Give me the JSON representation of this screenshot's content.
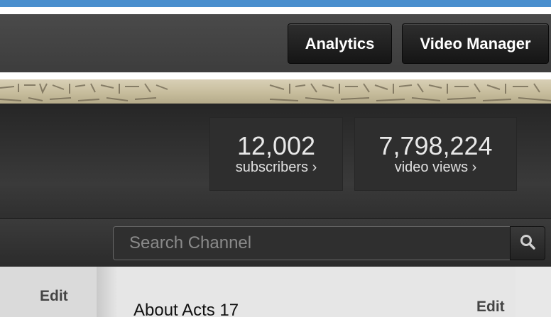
{
  "toolbar": {
    "analytics_label": "Analytics",
    "video_manager_label": "Video Manager"
  },
  "stats": {
    "subscribers_count": "12,002",
    "subscribers_label": "subscribers ›",
    "views_count": "7,798,224",
    "views_label": "video views ›"
  },
  "search": {
    "placeholder": "Search Channel",
    "icon": "search-icon"
  },
  "sidebar": {
    "edit_label": "Edit"
  },
  "main": {
    "about_title": "About Acts 17",
    "edit_label": "Edit"
  },
  "colors": {
    "top_bar": "#4a8fce",
    "toolbar_bg": "#444444",
    "header_bg": "#2e2e2e",
    "content_bg": "#e6e6e6"
  }
}
